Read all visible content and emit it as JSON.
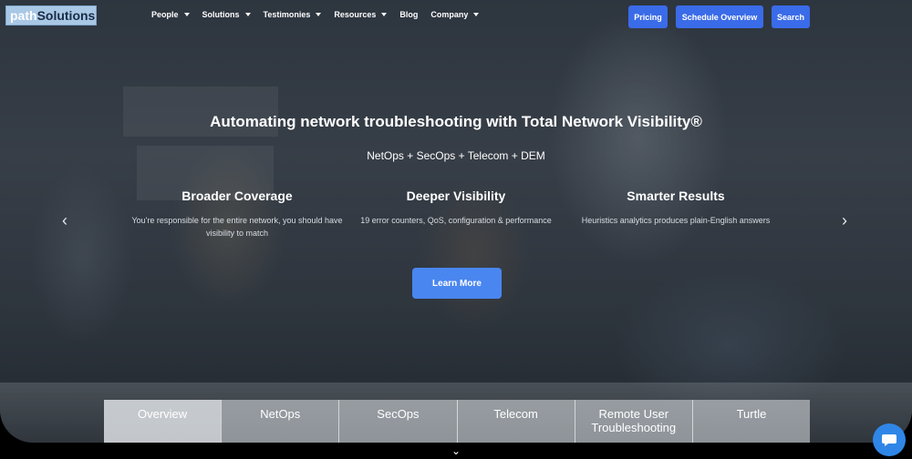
{
  "header": {
    "logo": {
      "part1": "path",
      "part2": "Solutions"
    },
    "nav": [
      {
        "label": "People",
        "dropdown": true
      },
      {
        "label": "Solutions",
        "dropdown": true
      },
      {
        "label": "Testimonies",
        "dropdown": true
      },
      {
        "label": "Resources",
        "dropdown": true
      },
      {
        "label": "Blog",
        "dropdown": false
      },
      {
        "label": "Company",
        "dropdown": true
      }
    ],
    "buttons": {
      "pricing": "Pricing",
      "schedule": "Schedule Overview",
      "search": "Search"
    }
  },
  "hero": {
    "headline": "Automating network troubleshooting with Total Network Visibility®",
    "subheadline": "NetOps + SecOps + Telecom + DEM",
    "features": [
      {
        "title": "Broader Coverage",
        "text": "You're responsible for the entire network, you should have visibility to match"
      },
      {
        "title": "Deeper Visibility",
        "text": "19 error counters, QoS, configuration & performance"
      },
      {
        "title": "Smarter Results",
        "text": "Heuristics analytics produces plain-English answers"
      }
    ],
    "cta": "Learn More",
    "prev_arrow": "‹",
    "next_arrow": "›"
  },
  "tabs": [
    "Overview",
    "NetOps",
    "SecOps",
    "Telecom",
    "Remote User Troubleshooting",
    "Turtle"
  ],
  "scroll_indicator": "⌄",
  "colors": {
    "accent": "#3a6be8",
    "cta": "#4a86f0",
    "chat": "#2f86e6"
  },
  "icons": {
    "chat": "chat-bubble-icon",
    "scroll": "chevron-down-icon"
  }
}
